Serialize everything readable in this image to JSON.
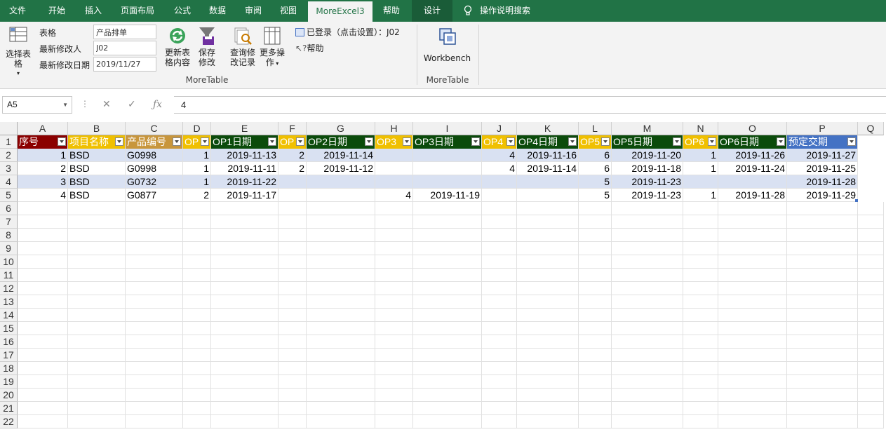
{
  "tabs": [
    {
      "label": "文件"
    },
    {
      "label": "开始"
    },
    {
      "label": "插入"
    },
    {
      "label": "页面布局"
    },
    {
      "label": "公式"
    },
    {
      "label": "数据"
    },
    {
      "label": "审阅"
    },
    {
      "label": "视图"
    },
    {
      "label": "MoreExcel3"
    },
    {
      "label": "帮助"
    },
    {
      "label": "设计"
    },
    {
      "label": "操作说明搜索"
    }
  ],
  "ribbon": {
    "select_table": "选择表格",
    "label_table": "表格",
    "label_last_modifier": "最新修改人",
    "label_last_modified_date": "最新修改日期",
    "value_table": "产品排单",
    "value_last_modifier": "J02",
    "value_last_modified_date": "2019/11/27",
    "refresh_label_1": "更新表",
    "refresh_label_2": "格内容",
    "save_label_1": "保存",
    "save_label_2": "修改",
    "query_label_1": "查询修",
    "query_label_2": "改记录",
    "more_label_1": "更多操",
    "more_label_2": "作",
    "logged_in": "已登录（点击设置）：J02",
    "help": "帮助",
    "workbench": "Workbench",
    "group_moretable_1": "MoreTable",
    "group_moretable_2": "MoreTable",
    "colors": {
      "ribbon_green": "#217346"
    }
  },
  "formula_bar": {
    "name_box": "A5",
    "formula": "4"
  },
  "sheet": {
    "columns": [
      "A",
      "B",
      "C",
      "D",
      "E",
      "F",
      "G",
      "H",
      "I",
      "J",
      "K",
      "L",
      "M",
      "N",
      "O",
      "P",
      "Q"
    ],
    "rows": [
      "1",
      "2",
      "3",
      "4",
      "5",
      "6",
      "7",
      "8",
      "9",
      "10",
      "11",
      "12",
      "13",
      "14",
      "15",
      "16",
      "17",
      "18",
      "19",
      "20",
      "21",
      "22"
    ],
    "headers": [
      "序号",
      "项目名称",
      "产品编号",
      "OP",
      "OP1日期",
      "OP",
      "OP2日期",
      "OP3",
      "OP3日期",
      "OP4",
      "OP4日期",
      "OP5",
      "OP5日期",
      "OP6",
      "OP6日期",
      "预定交期"
    ],
    "header_colors": [
      "#8b0000",
      "#f0c000",
      "#c8963c",
      "#f0c000",
      "#0b4b0b",
      "#f0c000",
      "#0b4b0b",
      "#f0c000",
      "#0b4b0b",
      "#f0c000",
      "#0b4b0b",
      "#f0c000",
      "#0b4b0b",
      "#f0c000",
      "#0b4b0b",
      "#4472c4"
    ],
    "data": [
      [
        "1",
        "BSD",
        "G0998",
        "1",
        "2019-11-13",
        "2",
        "2019-11-14",
        "",
        "",
        "4",
        "2019-11-16",
        "6",
        "2019-11-20",
        "1",
        "2019-11-26",
        "2019-11-27"
      ],
      [
        "2",
        "BSD",
        "G0998",
        "1",
        "2019-11-11",
        "2",
        "2019-11-12",
        "",
        "",
        "4",
        "2019-11-14",
        "6",
        "2019-11-18",
        "1",
        "2019-11-24",
        "2019-11-25"
      ],
      [
        "3",
        "BSD",
        "G0732",
        "1",
        "2019-11-22",
        "",
        "",
        "",
        "",
        "",
        "",
        "5",
        "2019-11-23",
        "",
        "",
        "2019-11-28"
      ],
      [
        "4",
        "BSD",
        "G0877",
        "2",
        "2019-11-17",
        "",
        "",
        "4",
        "2019-11-19",
        "",
        "",
        "5",
        "2019-11-23",
        "1",
        "2019-11-28",
        "2019-11-29"
      ]
    ]
  }
}
